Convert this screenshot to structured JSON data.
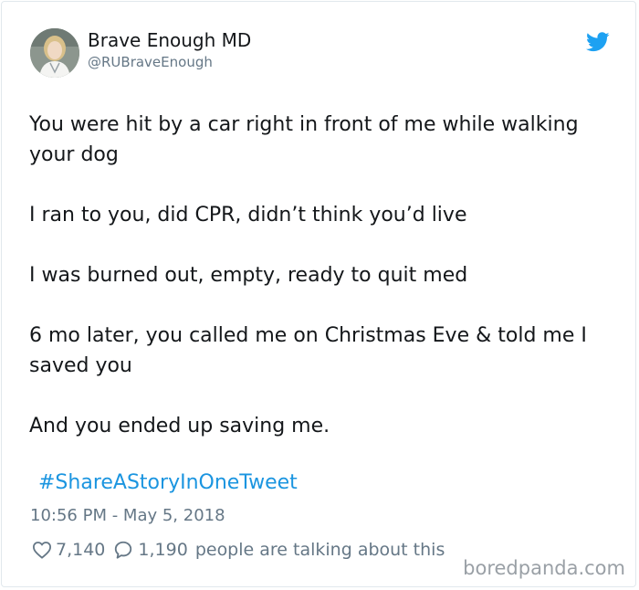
{
  "author": {
    "display_name": "Brave Enough MD",
    "handle": "@RUBraveEnough"
  },
  "icons": {
    "avatar": "profile-photo",
    "brand": "twitter-bird-icon",
    "like": "heart-outline-icon",
    "reply": "speech-bubble-icon"
  },
  "tweet": {
    "paragraphs": [
      "You were hit by a car right in front of me while walking your dog",
      "I ran to you, did CPR, didn’t think you’d live",
      "I was burned out, empty, ready to quit med",
      "6 mo later, you called me on Christmas Eve & told me I saved you",
      "And you ended up saving me."
    ],
    "hashtag": "#ShareAStoryInOneTweet",
    "timestamp": "10:56 PM - May 5, 2018"
  },
  "engagement": {
    "likes": "7,140",
    "replies": "1,190",
    "talking_label": "people are talking about this"
  },
  "watermark": "boredpanda.com",
  "colors": {
    "brand_blue": "#1da1f2",
    "link_blue": "#1b95e0",
    "muted_text": "#657786",
    "border": "#e1e8ed"
  }
}
